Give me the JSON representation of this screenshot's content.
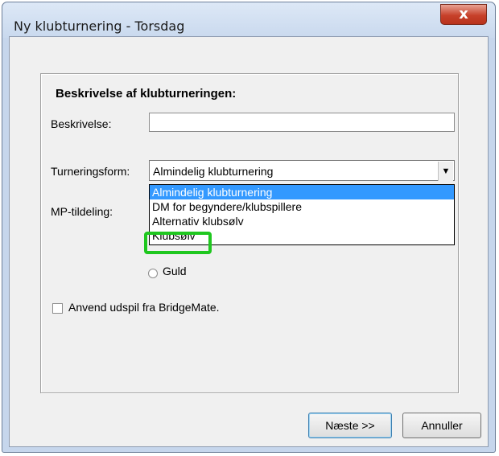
{
  "window": {
    "title": "Ny klubturnering - Torsdag",
    "close_label": "x"
  },
  "group": {
    "title": "Beskrivelse af klubturneringen:"
  },
  "description": {
    "label": "Beskrivelse:",
    "value": ""
  },
  "tournament_form": {
    "label": "Turneringsform:",
    "selected": "Almindelig klubturnering",
    "options": [
      "Almindelig klubturnering",
      "DM for begyndere/klubspillere",
      "Alternativ klubsølv",
      "Klubsølv"
    ],
    "highlight_color": "#1fc71f"
  },
  "mp": {
    "label": "MP-tildeling:",
    "radio_gold_label": "Guld"
  },
  "bridgemate": {
    "checkbox_label": "Anvend udspil fra BridgeMate."
  },
  "buttons": {
    "next_label": "Næste >>",
    "cancel_label": "Annuller"
  }
}
